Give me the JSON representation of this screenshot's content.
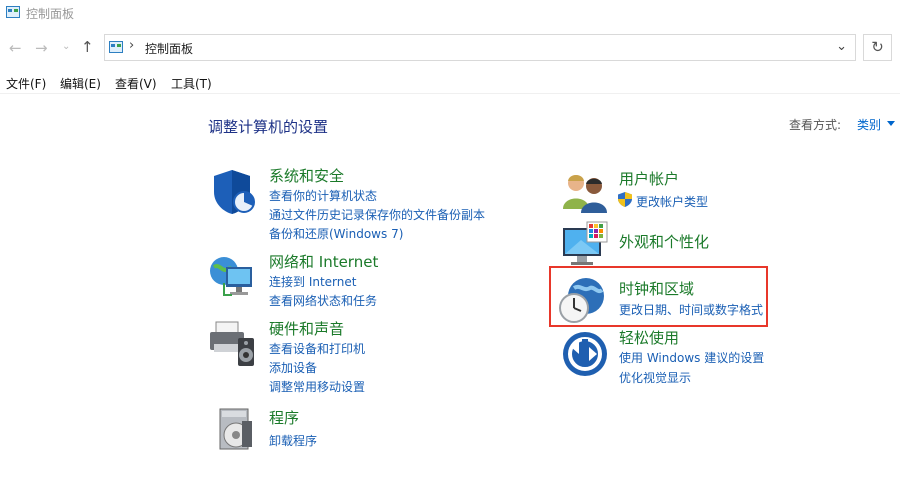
{
  "window": {
    "title": "控制面板"
  },
  "nav": {
    "breadcrumb": "控制面板"
  },
  "menu": [
    "文件(F)",
    "编辑(E)",
    "查看(V)",
    "工具(T)"
  ],
  "content": {
    "heading": "调整计算机的设置",
    "view_label": "查看方式:",
    "view_value": "类别",
    "categories": [
      {
        "title": "系统和安全",
        "links": [
          "查看你的计算机状态",
          "通过文件历史记录保存你的文件备份副本",
          "备份和还原(Windows 7)"
        ]
      },
      {
        "title": "网络和 Internet",
        "links": [
          "连接到 Internet",
          "查看网络状态和任务"
        ]
      },
      {
        "title": "硬件和声音",
        "links": [
          "查看设备和打印机",
          "添加设备",
          "调整常用移动设置"
        ]
      },
      {
        "title": "程序",
        "links": [
          "卸载程序"
        ]
      },
      {
        "title": "用户帐户",
        "links": [
          "更改帐户类型"
        ]
      },
      {
        "title": "外观和个性化",
        "links": []
      },
      {
        "title": "时钟和区域",
        "links": [
          "更改日期、时间或数字格式"
        ]
      },
      {
        "title": "轻松使用",
        "links": [
          "使用 Windows 建议的设置",
          "优化视觉显示"
        ]
      }
    ]
  },
  "colors": {
    "accent_link": "#1a5fb4",
    "category_title": "#1b7a2a",
    "highlight": "#e8372a"
  }
}
